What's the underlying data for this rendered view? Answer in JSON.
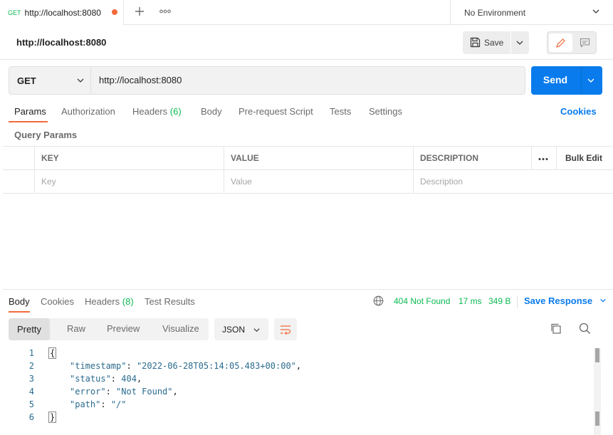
{
  "tabstrip": {
    "tab": {
      "method": "GET",
      "title": "http://localhost:8080"
    },
    "new_tab_icon": "plus-icon",
    "more_icon": "more-horizontal-icon",
    "environment": "No Environment"
  },
  "header": {
    "title": "http://localhost:8080",
    "save_label": "Save"
  },
  "request": {
    "method": "GET",
    "url": "http://localhost:8080",
    "send_label": "Send"
  },
  "request_tabs": {
    "params": "Params",
    "authorization": "Authorization",
    "headers": "Headers",
    "headers_count": "(6)",
    "body": "Body",
    "prerequest": "Pre-request Script",
    "tests": "Tests",
    "settings": "Settings",
    "cookies": "Cookies"
  },
  "query_params": {
    "title": "Query Params",
    "columns": [
      "KEY",
      "VALUE",
      "DESCRIPTION"
    ],
    "bulk_edit": "Bulk Edit",
    "placeholders": {
      "key": "Key",
      "value": "Value",
      "description": "Description"
    }
  },
  "response_tabs": {
    "body": "Body",
    "cookies": "Cookies",
    "headers": "Headers",
    "headers_count": "(8)",
    "test_results": "Test Results"
  },
  "response_status": {
    "status": "404 Not Found",
    "time": "17 ms",
    "size": "349 B",
    "save_response": "Save Response"
  },
  "response_view": {
    "formats": [
      "Pretty",
      "Raw",
      "Preview",
      "Visualize"
    ],
    "selected_format": "Pretty",
    "language": "JSON"
  },
  "code_lines": [
    {
      "num": "1",
      "text": "{"
    },
    {
      "num": "2",
      "key": "\"timestamp\"",
      "value": "\"2022-06-28T05:14:05.483+00:00\"",
      "tail": ","
    },
    {
      "num": "3",
      "key": "\"status\"",
      "value": "404",
      "tail": ","
    },
    {
      "num": "4",
      "key": "\"error\"",
      "value": "\"Not Found\"",
      "tail": ","
    },
    {
      "num": "5",
      "key": "\"path\"",
      "value": "\"/\"",
      "tail": ""
    },
    {
      "num": "6",
      "text": "}"
    }
  ],
  "colors": {
    "accent_orange": "#f26b3a",
    "primary_blue": "#097bed",
    "status_green": "#0cbb52",
    "json_key": "#2b6c8f"
  }
}
